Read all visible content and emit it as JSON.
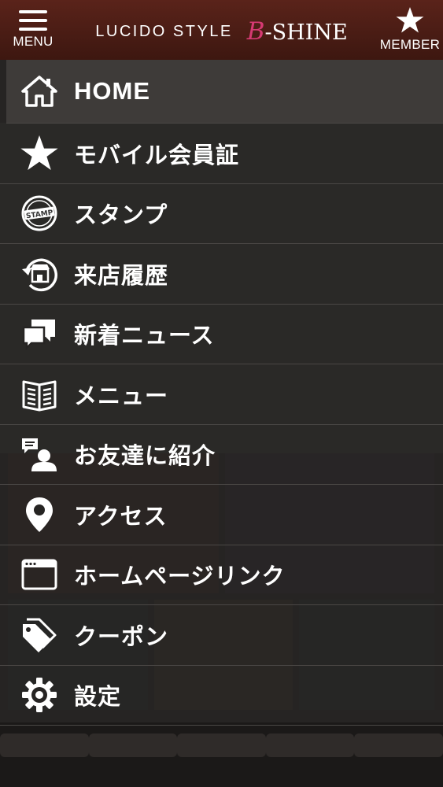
{
  "header": {
    "menu_label": "MENU",
    "member_label": "MEMBER",
    "logo_left": "LUCIDO STYLE",
    "logo_right_accent": "B",
    "logo_right_rest": "-SHINE"
  },
  "menu": {
    "items": [
      {
        "label": "HOME",
        "icon": "home-icon"
      },
      {
        "label": "モバイル会員証",
        "icon": "star-icon"
      },
      {
        "label": "スタンプ",
        "icon": "stamp-icon"
      },
      {
        "label": "来店履歴",
        "icon": "store-history-icon"
      },
      {
        "label": "新着ニュース",
        "icon": "chat-bubbles-icon"
      },
      {
        "label": "メニュー",
        "icon": "open-book-icon"
      },
      {
        "label": "お友達に紹介",
        "icon": "person-speech-icon"
      },
      {
        "label": "アクセス",
        "icon": "map-pin-icon"
      },
      {
        "label": "ホームページリンク",
        "icon": "browser-window-icon"
      },
      {
        "label": "クーポン",
        "icon": "tags-icon"
      },
      {
        "label": "設定",
        "icon": "gear-icon"
      }
    ]
  },
  "colors": {
    "header_top": "#5a231a",
    "header_bottom": "#3d1710",
    "drawer_bg": "#262423",
    "accent_pink": "#d63a73"
  }
}
